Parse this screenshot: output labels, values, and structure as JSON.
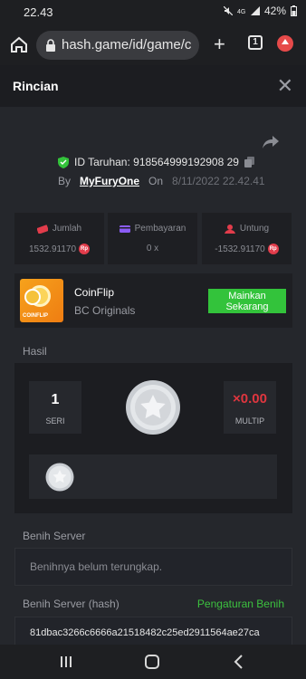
{
  "status_bar": {
    "time": "22.43",
    "battery": "42%"
  },
  "browser": {
    "url": "hash.game/id/game/c",
    "tab_count": "1"
  },
  "modal": {
    "title": "Rincian"
  },
  "bet": {
    "id_label": "ID Taruhan: 918564999192908 29",
    "by_label": "By",
    "user": "MyFuryOne",
    "on_label": "On",
    "date": "8/11/2022 22.42.41"
  },
  "stats": [
    {
      "label": "Jumlah",
      "value": "1532.91170",
      "icon": "money-icon",
      "color": "#e23c4b"
    },
    {
      "label": "Pembayaran",
      "value": "0 x",
      "icon": "card-icon",
      "color": "#8b5cf6"
    },
    {
      "label": "Untung",
      "value": "-1532.91170",
      "icon": "profit-icon",
      "color": "#e23c4b"
    }
  ],
  "currency_badge": "Rp",
  "game": {
    "thumb_label": "COINFLIP",
    "name": "CoinFlip",
    "provider": "BC Originals",
    "play_label": "Mainkan Sekarang"
  },
  "result": {
    "section_label": "Hasil",
    "series_value": "1",
    "series_label": "SERI",
    "multiplier_value": "×0.00",
    "multiplier_label": "MULTIP"
  },
  "server_seed": {
    "label": "Benih Server",
    "placeholder": "Benihnya belum terungkap."
  },
  "server_hash": {
    "label": "Benih Server (hash)",
    "settings_link": "Pengaturan Benih",
    "value": "81dbac3266c6666a21518482c25ed2911564ae27ca"
  }
}
